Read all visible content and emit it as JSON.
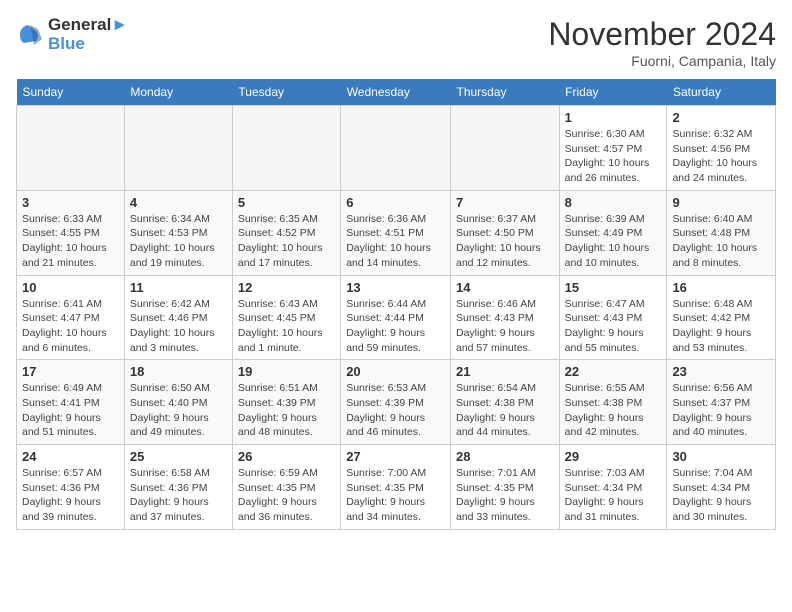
{
  "header": {
    "logo_line1": "General",
    "logo_line2": "Blue",
    "month_title": "November 2024",
    "location": "Fuorni, Campania, Italy"
  },
  "columns": [
    "Sunday",
    "Monday",
    "Tuesday",
    "Wednesday",
    "Thursday",
    "Friday",
    "Saturday"
  ],
  "weeks": [
    [
      {
        "day": "",
        "info": ""
      },
      {
        "day": "",
        "info": ""
      },
      {
        "day": "",
        "info": ""
      },
      {
        "day": "",
        "info": ""
      },
      {
        "day": "",
        "info": ""
      },
      {
        "day": "1",
        "info": "Sunrise: 6:30 AM\nSunset: 4:57 PM\nDaylight: 10 hours\nand 26 minutes."
      },
      {
        "day": "2",
        "info": "Sunrise: 6:32 AM\nSunset: 4:56 PM\nDaylight: 10 hours\nand 24 minutes."
      }
    ],
    [
      {
        "day": "3",
        "info": "Sunrise: 6:33 AM\nSunset: 4:55 PM\nDaylight: 10 hours\nand 21 minutes."
      },
      {
        "day": "4",
        "info": "Sunrise: 6:34 AM\nSunset: 4:53 PM\nDaylight: 10 hours\nand 19 minutes."
      },
      {
        "day": "5",
        "info": "Sunrise: 6:35 AM\nSunset: 4:52 PM\nDaylight: 10 hours\nand 17 minutes."
      },
      {
        "day": "6",
        "info": "Sunrise: 6:36 AM\nSunset: 4:51 PM\nDaylight: 10 hours\nand 14 minutes."
      },
      {
        "day": "7",
        "info": "Sunrise: 6:37 AM\nSunset: 4:50 PM\nDaylight: 10 hours\nand 12 minutes."
      },
      {
        "day": "8",
        "info": "Sunrise: 6:39 AM\nSunset: 4:49 PM\nDaylight: 10 hours\nand 10 minutes."
      },
      {
        "day": "9",
        "info": "Sunrise: 6:40 AM\nSunset: 4:48 PM\nDaylight: 10 hours\nand 8 minutes."
      }
    ],
    [
      {
        "day": "10",
        "info": "Sunrise: 6:41 AM\nSunset: 4:47 PM\nDaylight: 10 hours\nand 6 minutes."
      },
      {
        "day": "11",
        "info": "Sunrise: 6:42 AM\nSunset: 4:46 PM\nDaylight: 10 hours\nand 3 minutes."
      },
      {
        "day": "12",
        "info": "Sunrise: 6:43 AM\nSunset: 4:45 PM\nDaylight: 10 hours\nand 1 minute."
      },
      {
        "day": "13",
        "info": "Sunrise: 6:44 AM\nSunset: 4:44 PM\nDaylight: 9 hours\nand 59 minutes."
      },
      {
        "day": "14",
        "info": "Sunrise: 6:46 AM\nSunset: 4:43 PM\nDaylight: 9 hours\nand 57 minutes."
      },
      {
        "day": "15",
        "info": "Sunrise: 6:47 AM\nSunset: 4:43 PM\nDaylight: 9 hours\nand 55 minutes."
      },
      {
        "day": "16",
        "info": "Sunrise: 6:48 AM\nSunset: 4:42 PM\nDaylight: 9 hours\nand 53 minutes."
      }
    ],
    [
      {
        "day": "17",
        "info": "Sunrise: 6:49 AM\nSunset: 4:41 PM\nDaylight: 9 hours\nand 51 minutes."
      },
      {
        "day": "18",
        "info": "Sunrise: 6:50 AM\nSunset: 4:40 PM\nDaylight: 9 hours\nand 49 minutes."
      },
      {
        "day": "19",
        "info": "Sunrise: 6:51 AM\nSunset: 4:39 PM\nDaylight: 9 hours\nand 48 minutes."
      },
      {
        "day": "20",
        "info": "Sunrise: 6:53 AM\nSunset: 4:39 PM\nDaylight: 9 hours\nand 46 minutes."
      },
      {
        "day": "21",
        "info": "Sunrise: 6:54 AM\nSunset: 4:38 PM\nDaylight: 9 hours\nand 44 minutes."
      },
      {
        "day": "22",
        "info": "Sunrise: 6:55 AM\nSunset: 4:38 PM\nDaylight: 9 hours\nand 42 minutes."
      },
      {
        "day": "23",
        "info": "Sunrise: 6:56 AM\nSunset: 4:37 PM\nDaylight: 9 hours\nand 40 minutes."
      }
    ],
    [
      {
        "day": "24",
        "info": "Sunrise: 6:57 AM\nSunset: 4:36 PM\nDaylight: 9 hours\nand 39 minutes."
      },
      {
        "day": "25",
        "info": "Sunrise: 6:58 AM\nSunset: 4:36 PM\nDaylight: 9 hours\nand 37 minutes."
      },
      {
        "day": "26",
        "info": "Sunrise: 6:59 AM\nSunset: 4:35 PM\nDaylight: 9 hours\nand 36 minutes."
      },
      {
        "day": "27",
        "info": "Sunrise: 7:00 AM\nSunset: 4:35 PM\nDaylight: 9 hours\nand 34 minutes."
      },
      {
        "day": "28",
        "info": "Sunrise: 7:01 AM\nSunset: 4:35 PM\nDaylight: 9 hours\nand 33 minutes."
      },
      {
        "day": "29",
        "info": "Sunrise: 7:03 AM\nSunset: 4:34 PM\nDaylight: 9 hours\nand 31 minutes."
      },
      {
        "day": "30",
        "info": "Sunrise: 7:04 AM\nSunset: 4:34 PM\nDaylight: 9 hours\nand 30 minutes."
      }
    ]
  ]
}
